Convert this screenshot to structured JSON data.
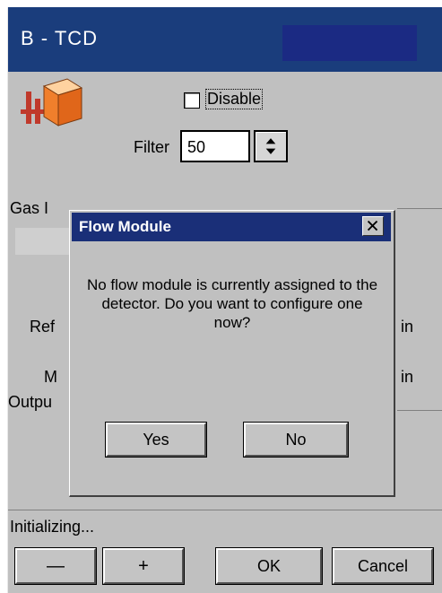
{
  "window": {
    "title": "B - TCD"
  },
  "detector": {
    "icon": "detector-icon",
    "disable_label": "Disable",
    "disable_checked": false,
    "filter_label": "Filter",
    "filter_value": "50"
  },
  "background_fragments": {
    "gas": "Gas I",
    "ref": "Ref",
    "m": "M",
    "output": "Outpu",
    "unit_1": "in",
    "unit_2": "in"
  },
  "status": {
    "text": "Initializing..."
  },
  "buttons": {
    "minus": "—",
    "plus": "+",
    "ok": "OK",
    "cancel": "Cancel"
  },
  "dialog": {
    "title": "Flow Module",
    "message": "No flow module is currently assigned to the detector. Do you want to configure one now?",
    "yes_label": "Yes",
    "no_label": "No",
    "close_icon": "close-icon"
  }
}
